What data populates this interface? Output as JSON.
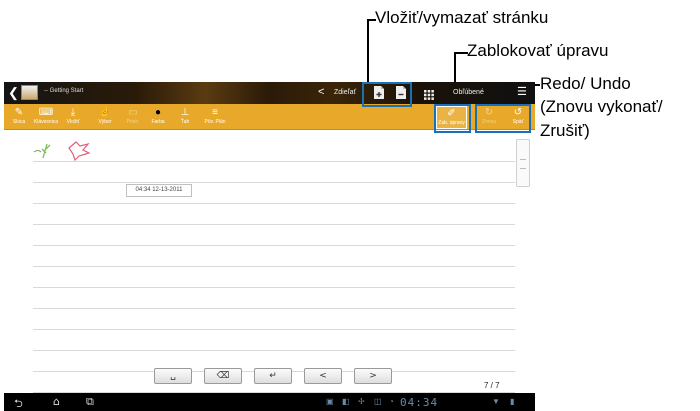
{
  "callouts": {
    "page_insert": "Vložiť/vymazať stránku",
    "lock_edit": "Zablokovať úpravu",
    "redo_undo_1": "Redo/ Undo",
    "redo_undo_2": "(Znovu vykonať/",
    "redo_undo_3": "Zrušiť)"
  },
  "titlebar": {
    "back_icon": "chevron-left-icon",
    "notebook_title": "-- Getting Start",
    "share_label": "Zdieľať",
    "favorites_label": "Obľúbené"
  },
  "toolbar": {
    "tools": [
      {
        "label": "Skica",
        "icon": "scribble-icon"
      },
      {
        "label": "Klávesnica",
        "icon": "keyboard-icon"
      },
      {
        "label": "Vložiť",
        "icon": "insert-icon"
      },
      {
        "label": "Výber",
        "icon": "select-icon"
      },
      {
        "label": "Prieh.",
        "icon": "text-icon"
      },
      {
        "label": "Farba",
        "icon": "color-dot-icon"
      },
      {
        "label": "Ťah",
        "icon": "stroke-icon"
      },
      {
        "label": "Pôv. Plán",
        "icon": "template-icon"
      }
    ],
    "lock_label": "Zab. úpravy",
    "redo_label": "Znovu",
    "undo_label": "Späť"
  },
  "paper": {
    "timestamp": "04:34 12-13-2011"
  },
  "keyboard": {
    "space": "␣",
    "backspace": "⌫",
    "enter": "↵",
    "left": "<",
    "right": ">"
  },
  "page_counter": "7 / 7",
  "navbar": {
    "clock": "04:34"
  },
  "colors": {
    "toolbar": "#e8a92a",
    "highlight": "#1a6fb5"
  }
}
